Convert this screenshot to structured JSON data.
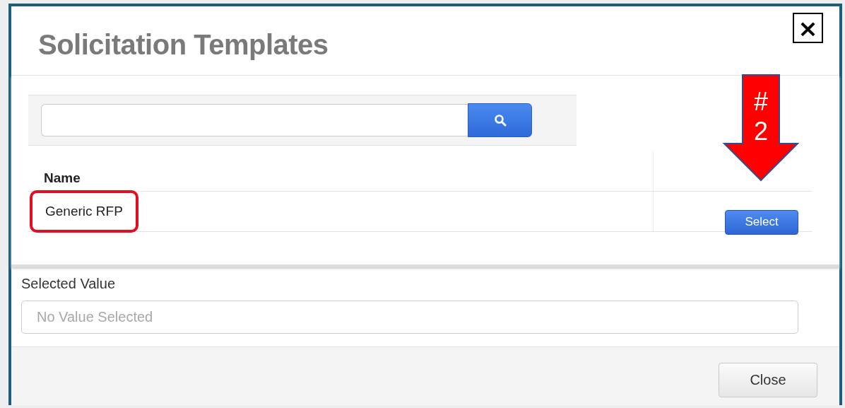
{
  "dialog": {
    "title": "Solicitation Templates",
    "close_icon": "×"
  },
  "table": {
    "columns": [
      "Name"
    ],
    "rows": [
      {
        "name": "Generic RFP",
        "highlighted": true,
        "action": "Select"
      }
    ]
  },
  "annotation": {
    "label": "# 2"
  },
  "selected_value": {
    "label": "Selected Value",
    "placeholder": "No Value Selected"
  },
  "buttons": [
    "Close"
  ]
}
